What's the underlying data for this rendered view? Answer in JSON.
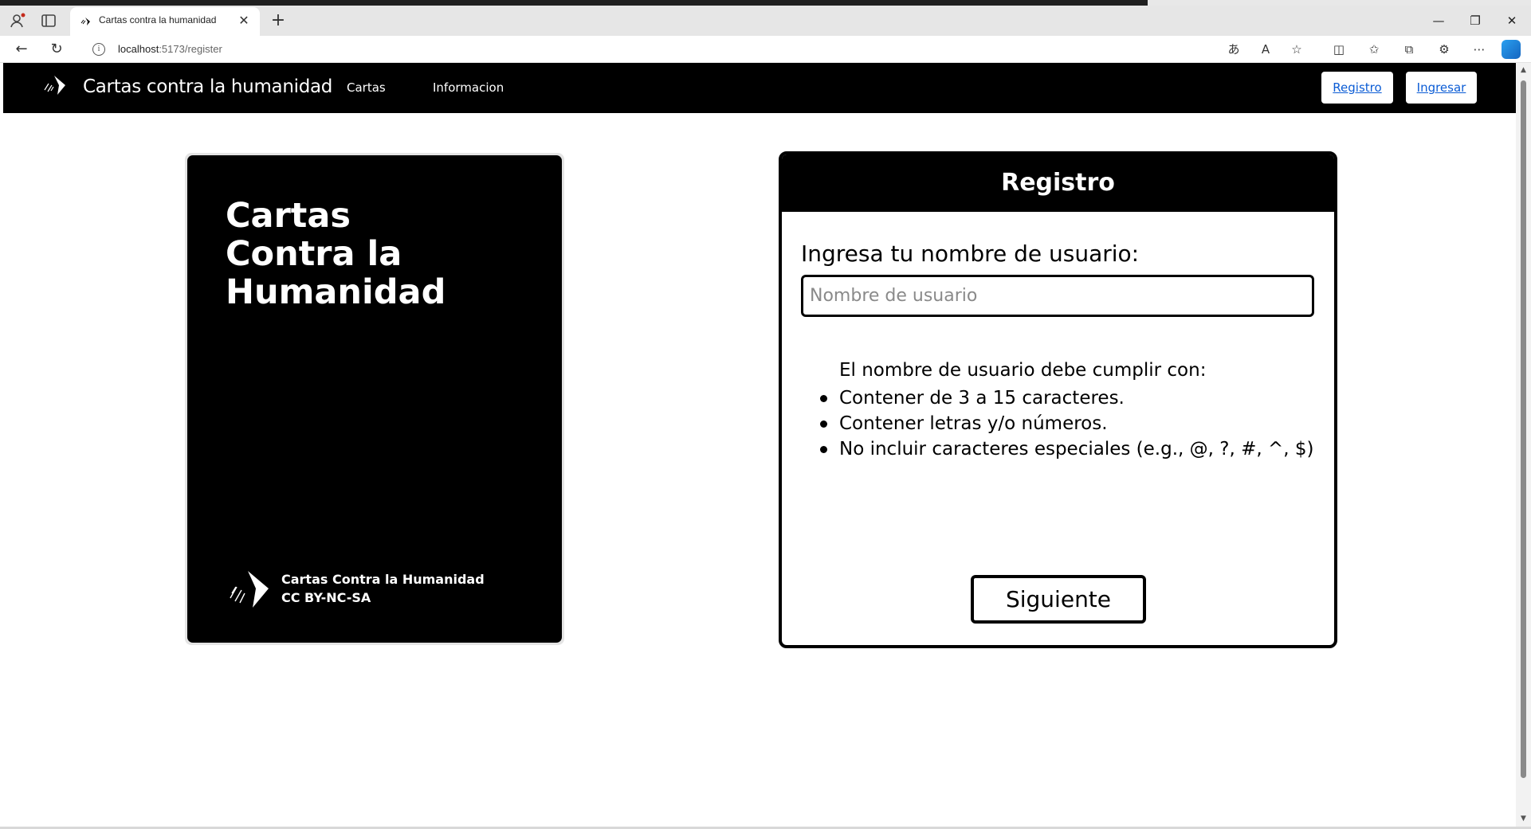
{
  "browser": {
    "tab_title": "Cartas contra la humanidad",
    "url_host": "localhost",
    "url_path": ":5173/register",
    "icons": [
      "profile-icon",
      "tab-actions-icon",
      "close-icon",
      "new-tab-icon",
      "back-icon",
      "refresh-icon",
      "site-info-icon",
      "translate-icon",
      "read-aloud-icon",
      "favorite-icon",
      "split-screen-icon",
      "favorites-icon",
      "collections-icon",
      "extensions-icon",
      "more-icon",
      "copilot-icon",
      "minimize-icon",
      "maximize-icon",
      "window-close-icon"
    ]
  },
  "navbar": {
    "brand": "Cartas contra la humanidad",
    "links": [
      "Cartas",
      "Informacion"
    ],
    "register_button": "Registro",
    "login_button": "Ingresar"
  },
  "card": {
    "title": "Cartas\nContra la\nHumanidad",
    "footer_line1": "Cartas Contra la Humanidad",
    "footer_line2": "CC BY-NC-SA"
  },
  "register": {
    "title": "Registro",
    "username_label": "Ingresa tu nombre de usuario:",
    "username_placeholder": "Nombre de usuario",
    "username_value": "",
    "rules_intro": "El nombre de usuario debe cumplir con:",
    "rules": [
      "Contener de 3 a 15 caracteres.",
      "Contener letras y/o números.",
      "No incluir caracteres especiales (e.g., @, ?, #, ^, $)"
    ],
    "submit_label": "Siguiente"
  },
  "colors": {
    "primary": "#000000",
    "background": "#ffffff",
    "link": "#0b5cd5"
  }
}
